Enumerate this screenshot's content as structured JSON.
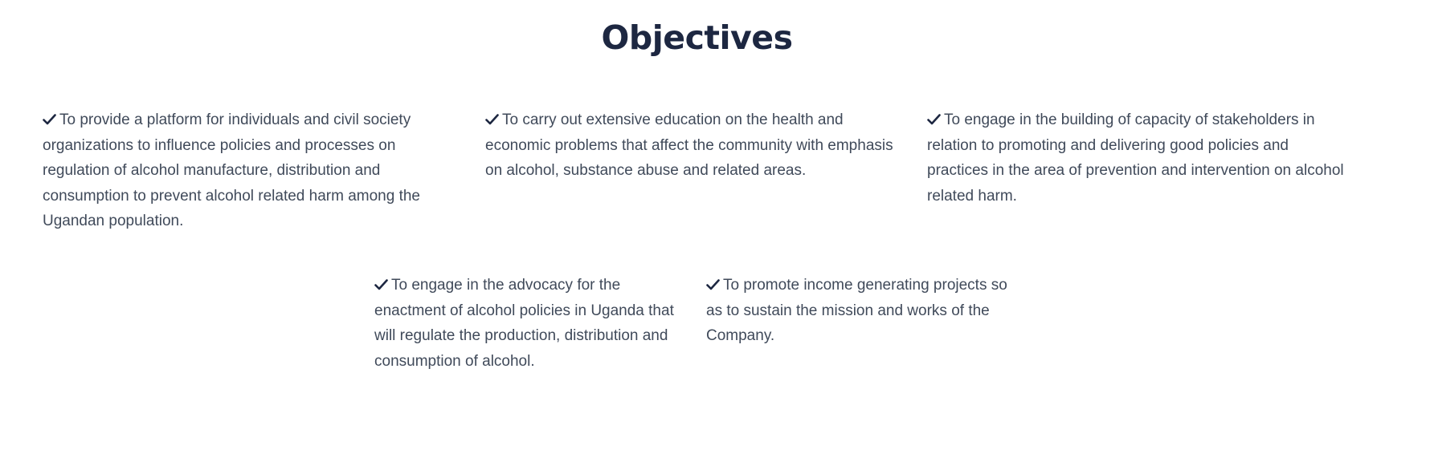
{
  "section": {
    "title": "Objectives"
  },
  "objectives": [
    {
      "text": "To provide a platform for individuals and civil society organizations to influence policies and processes on regulation of alcohol manufacture, distribution and consumption to prevent alcohol related harm among the Ugandan population.",
      "icon": "check-icon"
    },
    {
      "text": "To carry out extensive education on the health and economic problems that affect the community with emphasis on alcohol, substance abuse and related areas.",
      "icon": "check-icon"
    },
    {
      "text": "To engage in the building of capacity of stakeholders in relation to promoting and delivering good policies and practices in the area of prevention and intervention on alcohol related harm.",
      "icon": "check-icon"
    },
    {
      "text": "To engage in the advocacy for the enactment of alcohol policies in Uganda that will regulate the production, distribution and consumption of alcohol.",
      "icon": "check-icon"
    },
    {
      "text": "To promote income generating projects so as to sustain the mission and works of the Company.",
      "icon": "check-icon"
    }
  ],
  "colors": {
    "title": "#1d2741",
    "body_text": "#404a5a",
    "check": "#1d2741",
    "background": "#ffffff"
  }
}
